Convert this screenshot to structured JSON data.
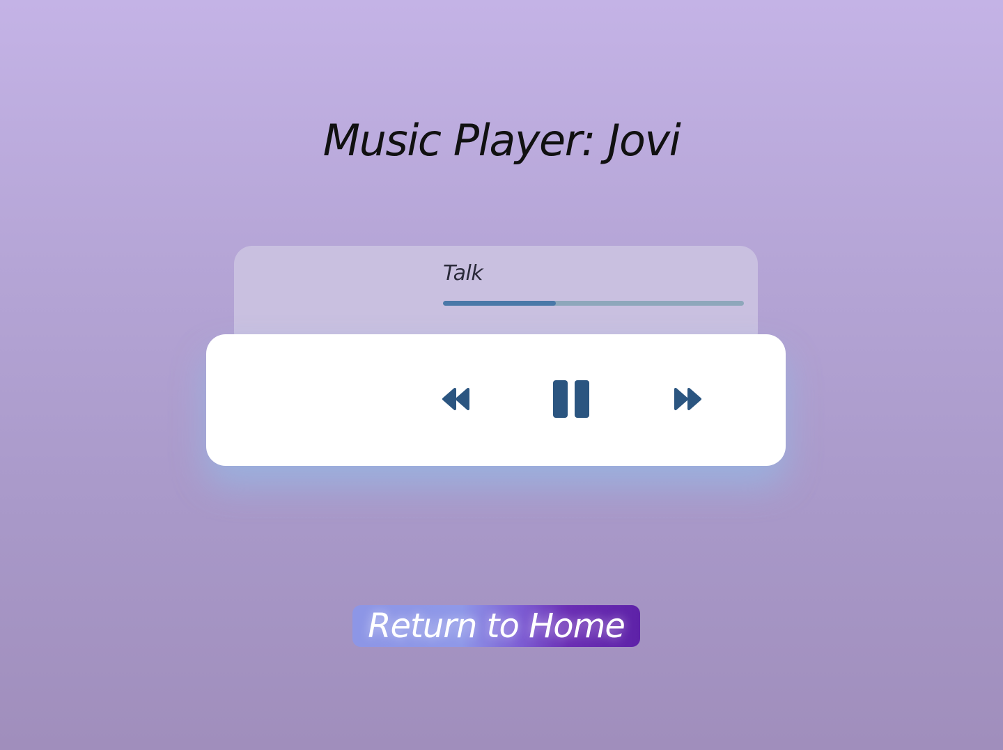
{
  "page": {
    "title": "Music Player: Jovi"
  },
  "player": {
    "track_name": "Talk",
    "progress": 0.375,
    "controls": {
      "previous_icon": "rewind-icon",
      "play_pause_icon": "pause-icon",
      "next_icon": "fast-forward-icon"
    },
    "colors": {
      "icon": "#2b5580",
      "progress_fill": "#4a78a8",
      "progress_track": "#8ea7bb"
    }
  },
  "nav": {
    "home_label": "Return to Home"
  }
}
